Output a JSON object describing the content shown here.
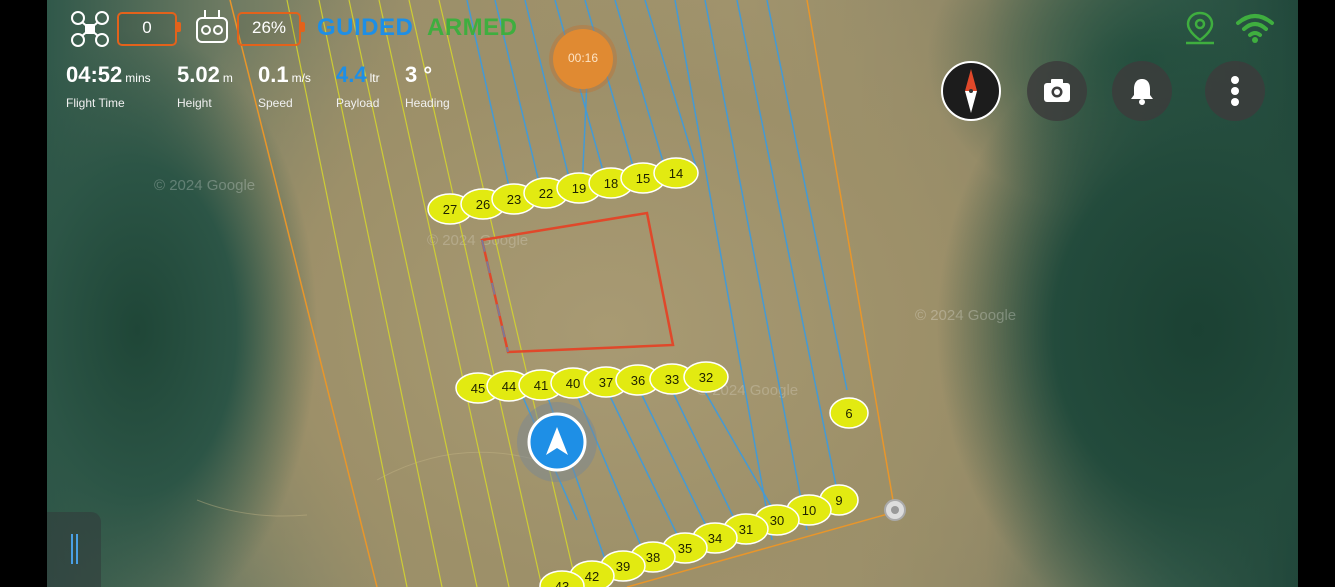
{
  "status_bar": {
    "drone_counter": "0",
    "battery_percent": "26%",
    "flight_mode": "GUIDED",
    "arm_state": "ARMED",
    "timer": "00:16"
  },
  "telemetry": [
    {
      "value": "04:52",
      "unit": "mins",
      "label": "Flight Time"
    },
    {
      "value": "5.02",
      "unit": "m",
      "label": "Height"
    },
    {
      "value": "0.1",
      "unit": "m/s",
      "label": "Speed"
    },
    {
      "value": "4.4",
      "unit": "ltr",
      "label": "Payload"
    },
    {
      "value": "3 °",
      "unit": "",
      "label": "Heading"
    }
  ],
  "waypoints": [
    "27",
    "26",
    "23",
    "22",
    "19",
    "18",
    "15",
    "14",
    "45",
    "44",
    "41",
    "40",
    "37",
    "36",
    "33",
    "32",
    "6",
    "9",
    "10",
    "30",
    "31",
    "34",
    "35",
    "38",
    "39",
    "42",
    "43"
  ],
  "map_watermark": "© 2024 Google",
  "colors": {
    "mode_blue": "#1e8fe6",
    "armed_green": "#3fae3f",
    "battery_orange": "#e3621b",
    "waypoint_yellow": "#e2ea11",
    "path_blue": "#3b9be0",
    "path_yellow": "#d7d82b",
    "boundary_orange": "#e9962a",
    "obstacle_red": "#e0482a"
  },
  "icons": {
    "drone": "drone-icon",
    "remote": "remote-controller-icon",
    "compass": "compass-icon",
    "camera": "camera-icon",
    "bell": "bell-icon",
    "menu": "more-vertical-icon",
    "gps": "location-pin-icon",
    "wifi": "wifi-icon"
  }
}
